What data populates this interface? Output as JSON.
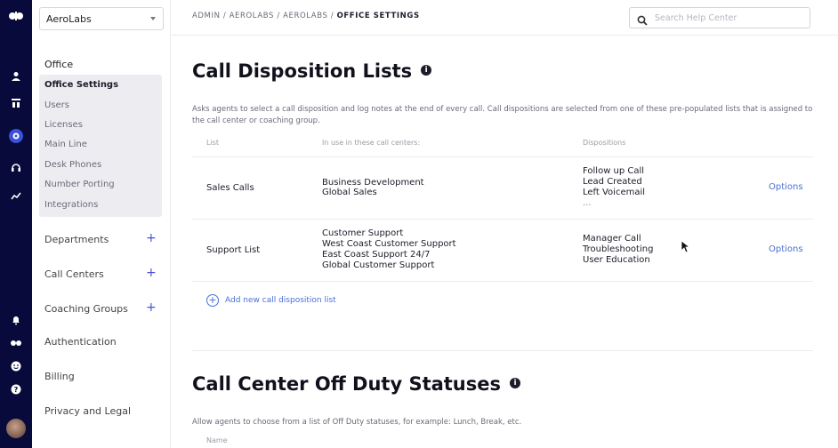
{
  "rail": {
    "icons": [
      "logo-icon",
      "user-icon",
      "admin-icon",
      "settings-icon",
      "headset-icon",
      "analytics-icon",
      "notification-icon",
      "dialpad-icon",
      "smiley-icon",
      "help-icon"
    ]
  },
  "sidebar": {
    "org_selector": "AeroLabs",
    "office": {
      "title": "Office",
      "items": [
        "Office Settings",
        "Users",
        "Licenses",
        "Main Line",
        "Desk Phones",
        "Number Porting",
        "Integrations"
      ]
    },
    "groups": [
      {
        "label": "Departments",
        "plus": "+"
      },
      {
        "label": "Call Centers",
        "plus": "+"
      },
      {
        "label": "Coaching Groups",
        "plus": "+"
      }
    ],
    "links": [
      "Authentication",
      "Billing",
      "Privacy and Legal"
    ]
  },
  "topbar": {
    "breadcrumb_prefix": "ADMIN / AEROLABS / AEROLABS / ",
    "breadcrumb_current": "OFFICE SETTINGS",
    "search_placeholder": "Search Help Center"
  },
  "section1": {
    "title": "Call Disposition Lists",
    "info_glyph": "i",
    "description": "Asks agents to select a call disposition and log notes at the end of every call. Call dispositions are selected from one of these pre-populated lists that is assigned to the call center or coaching group.",
    "headers": [
      "List",
      "In use in these call centers:",
      "Dispositions"
    ],
    "rows": [
      {
        "name": "Sales Calls",
        "centers": [
          "Business Development",
          "Global Sales"
        ],
        "dispositions": [
          "Follow up Call",
          "Lead Created",
          "Left Voicemail",
          "..."
        ],
        "options": "Options"
      },
      {
        "name": "Support List",
        "centers": [
          "Customer Support",
          "West Coast Customer Support",
          "East Coast Support 24/7",
          "Global Customer Support"
        ],
        "dispositions": [
          "Manager Call",
          "Troubleshooting",
          "User Education"
        ],
        "options": "Options"
      }
    ],
    "add_label": "Add new call disposition list",
    "add_glyph": "+"
  },
  "section2": {
    "title": "Call Center Off Duty Statuses",
    "info_glyph": "i",
    "description": "Allow agents to choose from a list of Off Duty statuses, for example: Lunch, Break, etc.",
    "header": "Name"
  },
  "colors": {
    "rail_bg": "#070a3a",
    "accent": "#4a6fd6",
    "submenu_bg": "#ededf1"
  }
}
